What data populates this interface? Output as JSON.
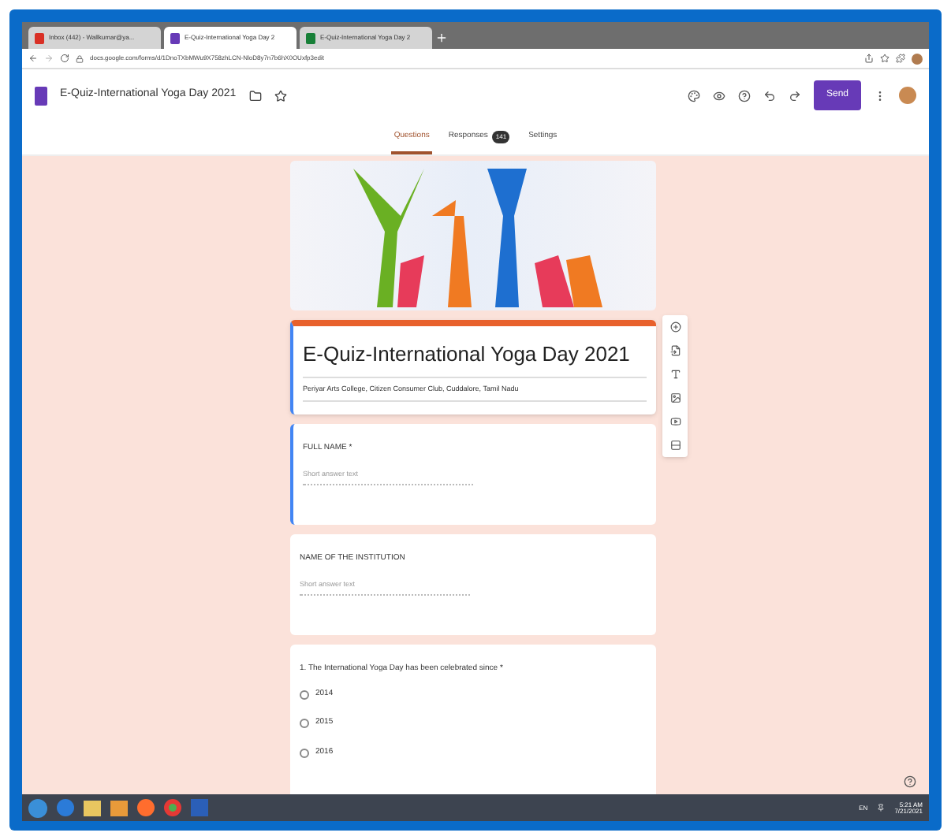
{
  "browser": {
    "tabs": [
      {
        "label": "Inbox (442) - Wallkumar@ya...",
        "selected": false,
        "kind": "mail"
      },
      {
        "label": "E-Quiz-International Yoga Day 2",
        "selected": true,
        "kind": "forms"
      },
      {
        "label": "E-Quiz-International Yoga Day 2",
        "selected": false,
        "kind": "sheets"
      }
    ],
    "url": "docs.google.com/forms/d/1DnoTXbMWu9X758zhLCN-NloD8y7n7b6hX0OUxfp3edit"
  },
  "header": {
    "title": "E-Quiz-International Yoga Day 2021",
    "send": "Send"
  },
  "form_tabs": [
    {
      "label": "Questions",
      "selected": true
    },
    {
      "label": "Responses",
      "selected": false,
      "count": "141"
    },
    {
      "label": "Settings",
      "selected": false
    }
  ],
  "form": {
    "title": "E-Quiz-International Yoga Day 2021",
    "description": "Periyar Arts College, Citizen Consumer Club, Cuddalore, Tamil Nadu",
    "questions": [
      {
        "kind": "short",
        "label": "FULL NAME *",
        "placeholder": "Short answer text",
        "selected": true
      },
      {
        "kind": "short",
        "label": "NAME OF THE INSTITUTION",
        "placeholder": "Short answer text",
        "selected": false
      },
      {
        "kind": "choice",
        "label": "1. The International Yoga Day has been celebrated since *",
        "selected": false,
        "options": [
          "2014",
          "2015",
          "2016"
        ]
      }
    ]
  },
  "taskbar": {
    "time": "5:21 AM",
    "date": "7/21/2021",
    "lang": "EN"
  }
}
